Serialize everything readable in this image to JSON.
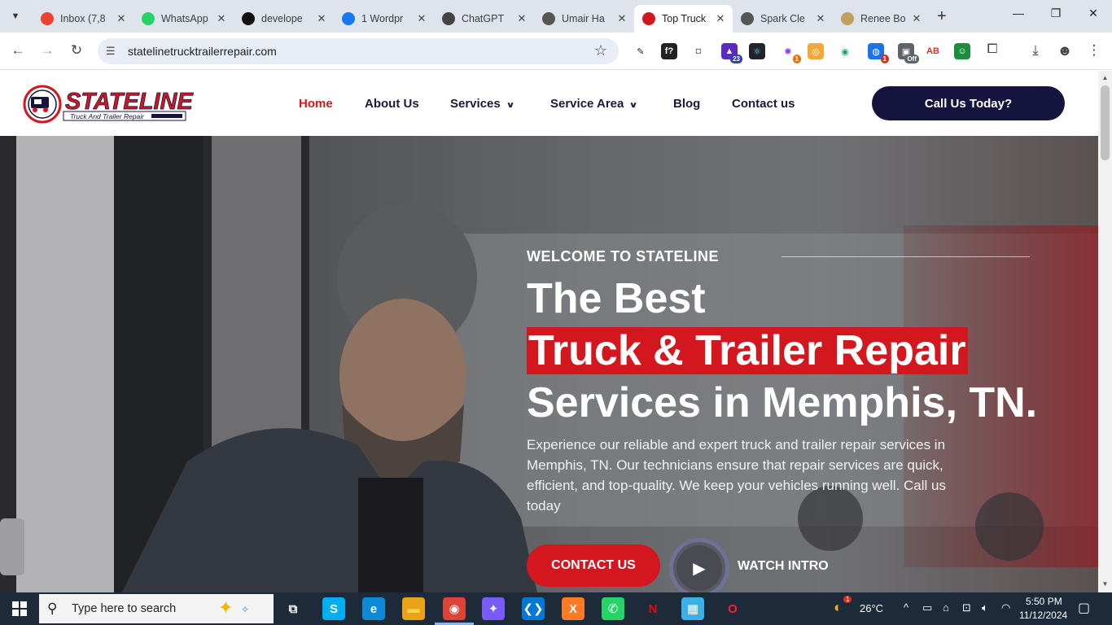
{
  "browser": {
    "tabs": [
      {
        "title": "Inbox (7,8",
        "favicon": "gmail-icon",
        "color": "#ea4335"
      },
      {
        "title": "WhatsApp",
        "favicon": "whatsapp-icon",
        "color": "#25d366"
      },
      {
        "title": "develope",
        "favicon": "github-icon",
        "color": "#111111"
      },
      {
        "title": "1 Wordpr",
        "favicon": "facebook-icon",
        "color": "#1877f2"
      },
      {
        "title": "ChatGPT",
        "favicon": "chatgpt-icon",
        "color": "#444444"
      },
      {
        "title": "Umair Ha",
        "favicon": "globe-icon",
        "color": "#555555"
      },
      {
        "title": "Top Truck",
        "favicon": "stateline-icon",
        "color": "#d2171e",
        "active": true
      },
      {
        "title": "Spark Cle",
        "favicon": "globe-icon",
        "color": "#555555"
      },
      {
        "title": "Renee Bo",
        "favicon": "site-icon",
        "color": "#c0a060"
      }
    ],
    "url": "statelinetrucktrailerrepair.com",
    "extensions": [
      {
        "name": "eyedropper-icon",
        "glyph": "✎",
        "bg": "#ffffff",
        "fg": "#222222"
      },
      {
        "name": "fonts-ninja-icon",
        "glyph": "f?",
        "bg": "#222222",
        "fg": "#ffffff"
      },
      {
        "name": "camera-icon",
        "glyph": "◘",
        "bg": "#ffffff",
        "fg": "#777777"
      },
      {
        "name": "graduation-icon",
        "glyph": "▲",
        "bg": "#5b2bbf",
        "fg": "#ffffff",
        "badge": "23",
        "badge_bg": "#3b3bb0"
      },
      {
        "name": "react-icon",
        "glyph": "⚛",
        "bg": "#20232a",
        "fg": "#61dafb"
      },
      {
        "name": "colorful-burst-icon",
        "glyph": "✺",
        "bg": "#ffffff",
        "fg": "#7b3fe4",
        "badge": "1",
        "badge_bg": "#e8710a"
      },
      {
        "name": "orange-square-icon",
        "glyph": "◎",
        "bg": "#f4a836",
        "fg": "#ffffff"
      },
      {
        "name": "green-eye-icon",
        "glyph": "◉",
        "bg": "#ffffff",
        "fg": "#1aa260"
      },
      {
        "name": "globe-badge-icon",
        "glyph": "◍",
        "bg": "#1a73e8",
        "fg": "#ffffff",
        "badge": "1",
        "badge_bg": "#d93025"
      },
      {
        "name": "off-toggle-icon",
        "glyph": "▣",
        "bg": "#5f6368",
        "fg": "#ffffff",
        "badge": "Off",
        "badge_bg": "#5f6368"
      },
      {
        "name": "pdf-icon",
        "glyph": "AB",
        "bg": "#ffffff",
        "fg": "#d93025"
      },
      {
        "name": "green-bot-icon",
        "glyph": "☺",
        "bg": "#1e8e3e",
        "fg": "#ffffff"
      }
    ]
  },
  "site": {
    "brand": "STATELINE",
    "tagline": "Truck And Trailer Repair",
    "nav": [
      {
        "label": "Home",
        "active": true
      },
      {
        "label": "About Us"
      },
      {
        "label": "Services",
        "dropdown": true
      },
      {
        "label": "Service Area",
        "dropdown": true
      },
      {
        "label": "Blog"
      },
      {
        "label": "Contact us"
      }
    ],
    "cta": "Call Us Today?",
    "accent": "#d2171e",
    "navy": "#14143f"
  },
  "hero": {
    "eyebrow": "WELCOME TO STATELINE",
    "line1": "The Best",
    "line2": "Truck & Trailer Repair",
    "line3": "Services in Memphis, TN.",
    "description": "Experience our reliable and expert truck and trailer repair services in Memphis, TN. Our technicians ensure that repair services are quick, efficient, and top-quality. We keep your vehicles running well. Call us today",
    "contact_button": "CONTACT US",
    "watch_label": "WATCH INTRO"
  },
  "taskbar": {
    "search_placeholder": "Type here to search",
    "weather": "26°C",
    "weather_badge": "1",
    "time": "5:50 PM",
    "date": "11/12/2024",
    "apps": [
      {
        "name": "task-view-icon",
        "glyph": "⧉",
        "fg": "#ffffff",
        "bg": "transparent"
      },
      {
        "name": "skype-icon",
        "glyph": "S",
        "fg": "#ffffff",
        "bg": "#00aff0"
      },
      {
        "name": "edge-icon",
        "glyph": "e",
        "fg": "#ffffff",
        "bg": "#0c8ad6"
      },
      {
        "name": "file-explorer-icon",
        "glyph": "▬",
        "fg": "#ffd34d",
        "bg": "#e8a317"
      },
      {
        "name": "chrome-icon",
        "glyph": "◉",
        "fg": "#ffffff",
        "bg": "#db4437"
      },
      {
        "name": "copilot-icon",
        "glyph": "✦",
        "fg": "#ffffff",
        "bg": "#7a5af8"
      },
      {
        "name": "vscode-icon",
        "glyph": "❮❯",
        "fg": "#ffffff",
        "bg": "#0078d4"
      },
      {
        "name": "xampp-icon",
        "glyph": "X",
        "fg": "#ffffff",
        "bg": "#fb7a24"
      },
      {
        "name": "whatsapp-taskbar-icon",
        "glyph": "✆",
        "fg": "#ffffff",
        "bg": "#25d366"
      },
      {
        "name": "netflix-icon",
        "glyph": "N",
        "fg": "#e50914",
        "bg": "transparent"
      },
      {
        "name": "store-icon",
        "glyph": "▦",
        "fg": "#ffffff",
        "bg": "#3ab0e6"
      },
      {
        "name": "opera-icon",
        "glyph": "O",
        "fg": "#ff1b2d",
        "bg": "transparent"
      }
    ]
  }
}
